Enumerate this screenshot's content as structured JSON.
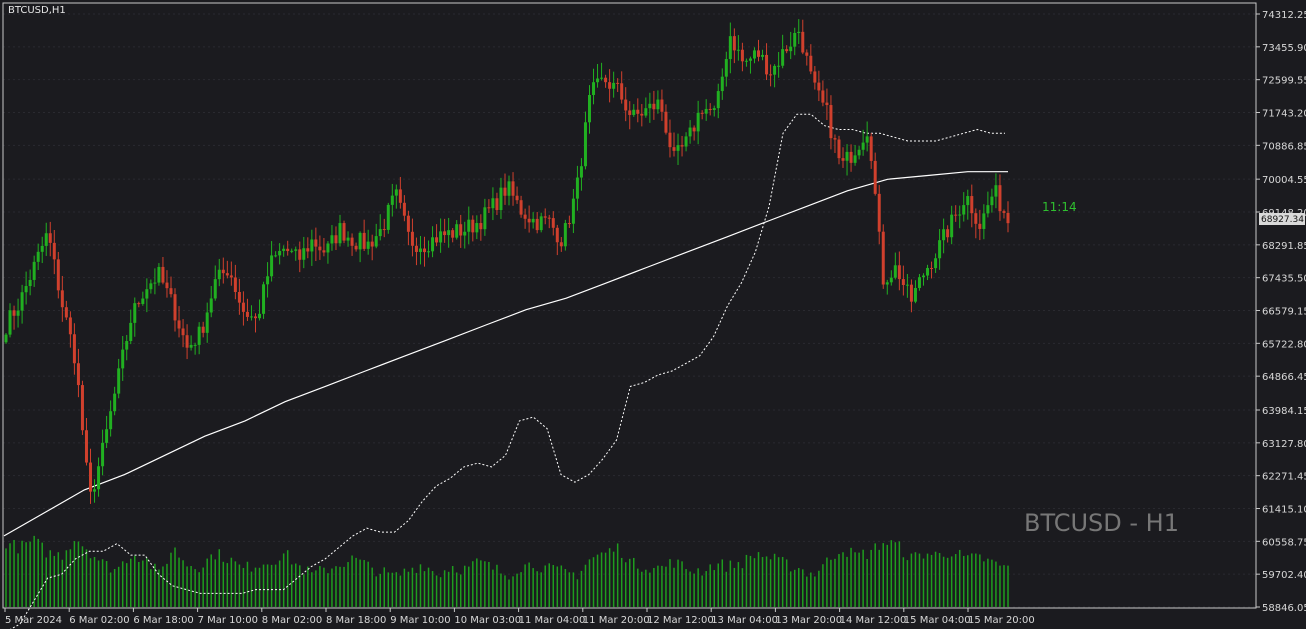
{
  "symbol_label": "BTCUSD,H1",
  "watermark": "BTCUSD - H1",
  "countdown": "11:14",
  "current_price_label": "68927.34",
  "colors": {
    "background": "#1b1b1f",
    "frame": "#c8c8c8",
    "bull": "#21b021",
    "bear": "#d0402d",
    "volume": "#1f9d1f",
    "ma": "#ffffff",
    "band": "#ffffff",
    "grid": "#2a2a30"
  },
  "chart_data": {
    "type": "candlestick",
    "title": "BTCUSD,H1",
    "ylim": [
      58846.05,
      74312.25
    ],
    "y_ticks": [
      "74312.25",
      "73455.90",
      "72599.55",
      "71743.20",
      "70886.85",
      "70004.55",
      "69148.20",
      "68291.85",
      "67435.50",
      "66579.15",
      "65722.80",
      "64866.45",
      "63984.15",
      "63127.80",
      "62271.45",
      "61415.10",
      "60558.75",
      "59702.40",
      "58846.05"
    ],
    "x_ticks": [
      "5 Mar 2024",
      "6 Mar 02:00",
      "6 Mar 18:00",
      "7 Mar 10:00",
      "8 Mar 02:00",
      "8 Mar 18:00",
      "9 Mar 10:00",
      "10 Mar 03:00",
      "11 Mar 04:00",
      "11 Mar 20:00",
      "12 Mar 12:00",
      "13 Mar 04:00",
      "13 Mar 20:00",
      "14 Mar 12:00",
      "15 Mar 04:00",
      "15 Mar 20:00"
    ],
    "close_path": [
      66200,
      66800,
      67700,
      68600,
      66800,
      65300,
      61600,
      63000,
      64700,
      66400,
      67200,
      67500,
      66700,
      65600,
      66000,
      67300,
      67700,
      66600,
      66300,
      67800,
      68200,
      67900,
      68400,
      68100,
      68700,
      68400,
      68300,
      68700,
      69600,
      68400,
      68300,
      68500,
      68600,
      68700,
      68900,
      69300,
      69800,
      69200,
      68900,
      68900,
      68400,
      69700,
      72200,
      72600,
      72300,
      71600,
      71800,
      72000,
      70500,
      71000,
      71900,
      71700,
      73800,
      73000,
      73300,
      72800,
      73400,
      73900,
      72400,
      71700,
      70300,
      70800,
      71400,
      67400,
      67700,
      66800,
      67600,
      68200,
      68900,
      69600,
      68800,
      69700,
      68950
    ],
    "upper_band_path": [
      58200,
      58400,
      59000,
      59600,
      59700,
      60100,
      60300,
      60300,
      60500,
      60200,
      60200,
      59700,
      59400,
      59300,
      59200,
      59200,
      59200,
      59200,
      59300,
      59300,
      59300,
      59600,
      59900,
      60100,
      60400,
      60700,
      60900,
      60800,
      60800,
      61100,
      61600,
      62000,
      62200,
      62500,
      62600,
      62500,
      62800,
      63700,
      63800,
      63500,
      62300,
      62100,
      62300,
      62700,
      63200,
      64600,
      64700,
      64900,
      65000,
      65200,
      65400,
      65900,
      66700,
      67300,
      68100,
      69300,
      71200,
      71700,
      71700,
      71400,
      71300,
      71300,
      71200,
      71200,
      71100,
      71000,
      71000,
      71000,
      71100,
      71200,
      71300,
      71200,
      71200
    ],
    "ma_path": [
      60700,
      61300,
      61900,
      62300,
      62800,
      63300,
      63700,
      64200,
      64600,
      65000,
      65400,
      65800,
      66200,
      66600,
      66900,
      67300,
      67700,
      68100,
      68500,
      68900,
      69300,
      69700,
      70000,
      70100,
      70200,
      70200
    ],
    "volume_path": [
      60,
      55,
      62,
      50,
      48,
      65,
      52,
      40,
      35,
      50,
      45,
      30,
      55,
      40,
      38,
      50,
      45,
      35,
      40,
      42,
      50,
      38,
      30,
      35,
      40,
      45,
      38,
      32,
      28,
      35,
      40,
      30,
      38,
      35,
      42,
      36,
      30,
      38,
      40,
      35,
      33,
      30,
      45,
      50,
      55,
      40,
      38,
      36,
      42,
      35,
      34,
      40,
      38,
      42,
      50,
      45,
      40,
      36,
      30,
      42,
      55,
      48,
      50,
      60,
      58,
      45,
      50,
      48,
      52,
      44,
      46,
      40,
      36
    ]
  }
}
